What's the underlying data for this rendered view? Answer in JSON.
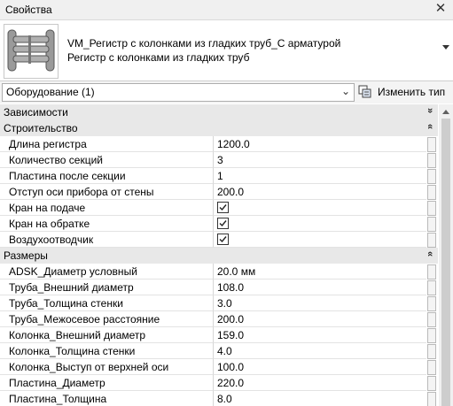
{
  "window": {
    "title": "Свойства",
    "close_glyph": "✕"
  },
  "type_selector": {
    "family": "VM_Регистр с колонками из гладких труб_С арматурой",
    "type": "Регистр с колонками из гладких труб"
  },
  "filter": {
    "selected": "Оборудование (1)",
    "edit_type_label": "Изменить тип"
  },
  "sections": [
    {
      "title": "Зависимости",
      "collapse_glyph": "»",
      "rows": []
    },
    {
      "title": "Строительство",
      "collapse_glyph": "«",
      "rows": [
        {
          "name": "Длина регистра",
          "value": "1200.0"
        },
        {
          "name": "Количество секций",
          "value": "3"
        },
        {
          "name": "Пластина после секции",
          "value": "1"
        },
        {
          "name": "Отступ оси прибора от стены",
          "value": "200.0"
        },
        {
          "name": "Кран на подаче",
          "checked": true
        },
        {
          "name": "Кран на обратке",
          "checked": true
        },
        {
          "name": "Воздухоотводчик",
          "checked": true
        }
      ]
    },
    {
      "title": "Размеры",
      "collapse_glyph": "«",
      "rows": [
        {
          "name": "ADSK_Диаметр условный",
          "value": "20.0 мм"
        },
        {
          "name": "Труба_Внешний диаметр",
          "value": "108.0"
        },
        {
          "name": "Труба_Толщина стенки",
          "value": "3.0"
        },
        {
          "name": "Труба_Межосевое расстояние",
          "value": "200.0"
        },
        {
          "name": "Колонка_Внешний диаметр",
          "value": "159.0"
        },
        {
          "name": "Колонка_Толщина стенки",
          "value": "4.0"
        },
        {
          "name": "Колонка_Выступ от верхней оси",
          "value": "100.0"
        },
        {
          "name": "Пластина_Диаметр",
          "value": "220.0"
        },
        {
          "name": "Пластина_Толщина",
          "value": "8.0"
        }
      ]
    }
  ]
}
